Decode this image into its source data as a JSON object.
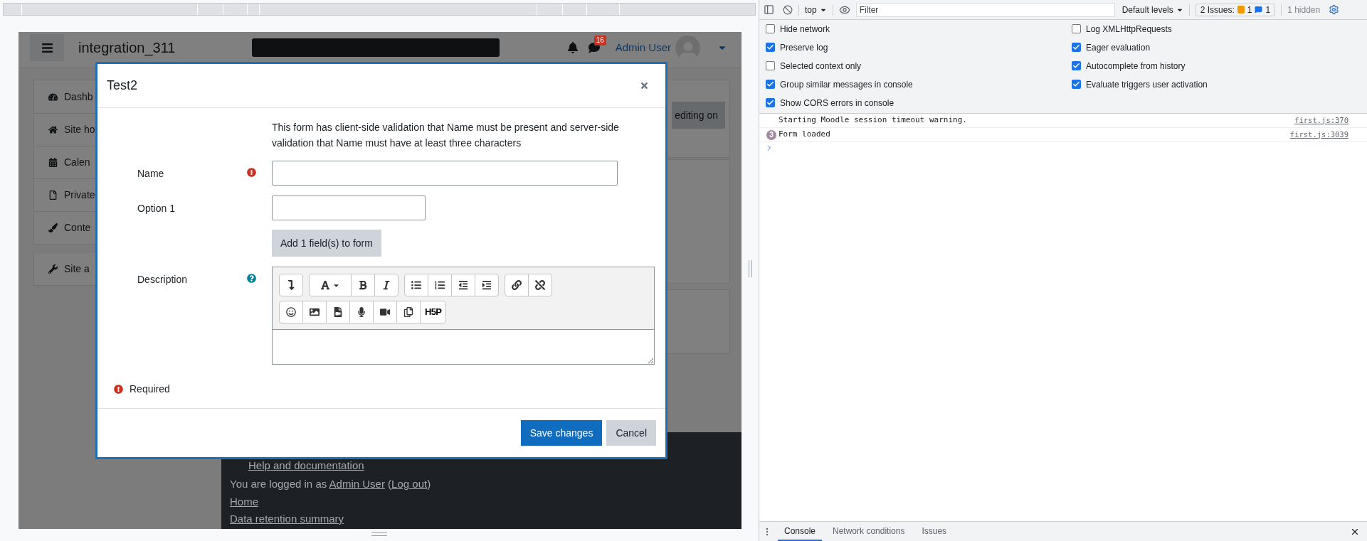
{
  "page": {
    "site_name": "integration_311",
    "notification_count": "16",
    "user_name": "Admin User",
    "nav_groups": [
      [
        {
          "label": "Dashb"
        },
        {
          "label": "Site ho"
        },
        {
          "label": "Calen"
        },
        {
          "label": "Private"
        },
        {
          "label": "Conte"
        }
      ],
      [
        {
          "label": "Site a"
        }
      ]
    ],
    "editing_button": "editing on",
    "footer": {
      "help_link": "Help and documentation",
      "logged_in": [
        {
          "kind": "text",
          "text": "You are logged in as "
        },
        {
          "kind": "link",
          "text": "Admin User"
        },
        {
          "kind": "text",
          "text": " ("
        },
        {
          "kind": "link",
          "text": "Log out"
        },
        {
          "kind": "text",
          "text": ")"
        }
      ],
      "links": [
        "Home",
        "Data retention summary"
      ]
    }
  },
  "modal": {
    "title": "Test2",
    "intro": "This form has client-side validation that Name must be present and server-side validation that Name must have at least three characters",
    "rows": [
      {
        "kind": "long-text",
        "label": "Name",
        "required": true,
        "help": false
      },
      {
        "kind": "short-text",
        "label": "Option 1",
        "required": false,
        "help": false
      },
      {
        "kind": "button",
        "label": "Add 1 field(s) to form",
        "required": false,
        "help": false
      },
      {
        "kind": "editor",
        "label": "Description",
        "required": false,
        "help": true
      }
    ],
    "h5p_label": "H5P",
    "required_note": "Required",
    "buttons": [
      {
        "label": "Save changes",
        "primary": true
      },
      {
        "label": "Cancel",
        "primary": false
      }
    ]
  },
  "devtools": {
    "toolbar": {
      "context": "top",
      "filter_placeholder": "Filter",
      "levels": "Default levels",
      "issues_label": "2 Issues:",
      "warning_count": "1",
      "info_count": "1",
      "hidden": "1 hidden"
    },
    "settings_left": [
      {
        "label": "Hide network",
        "checked": false
      },
      {
        "label": "Preserve log",
        "checked": true
      },
      {
        "label": "Selected context only",
        "checked": false
      },
      {
        "label": "Group similar messages in console",
        "checked": true
      },
      {
        "label": "Show CORS errors in console",
        "checked": true
      }
    ],
    "settings_right": [
      {
        "label": "Log XMLHttpRequests",
        "checked": false
      },
      {
        "label": "Eager evaluation",
        "checked": true
      },
      {
        "label": "Autocomplete from history",
        "checked": true
      },
      {
        "label": "Evaluate triggers user activation",
        "checked": true
      }
    ],
    "messages": [
      {
        "text": "Starting Moodle session timeout warning.",
        "source": "first.js:370"
      },
      {
        "text": "Form loaded",
        "source": "first.js:3039",
        "repeat": "3"
      }
    ],
    "drawer_tabs": [
      {
        "label": "Console",
        "selected": true
      },
      {
        "label": "Network conditions",
        "selected": false
      },
      {
        "label": "Issues",
        "selected": false
      }
    ]
  }
}
